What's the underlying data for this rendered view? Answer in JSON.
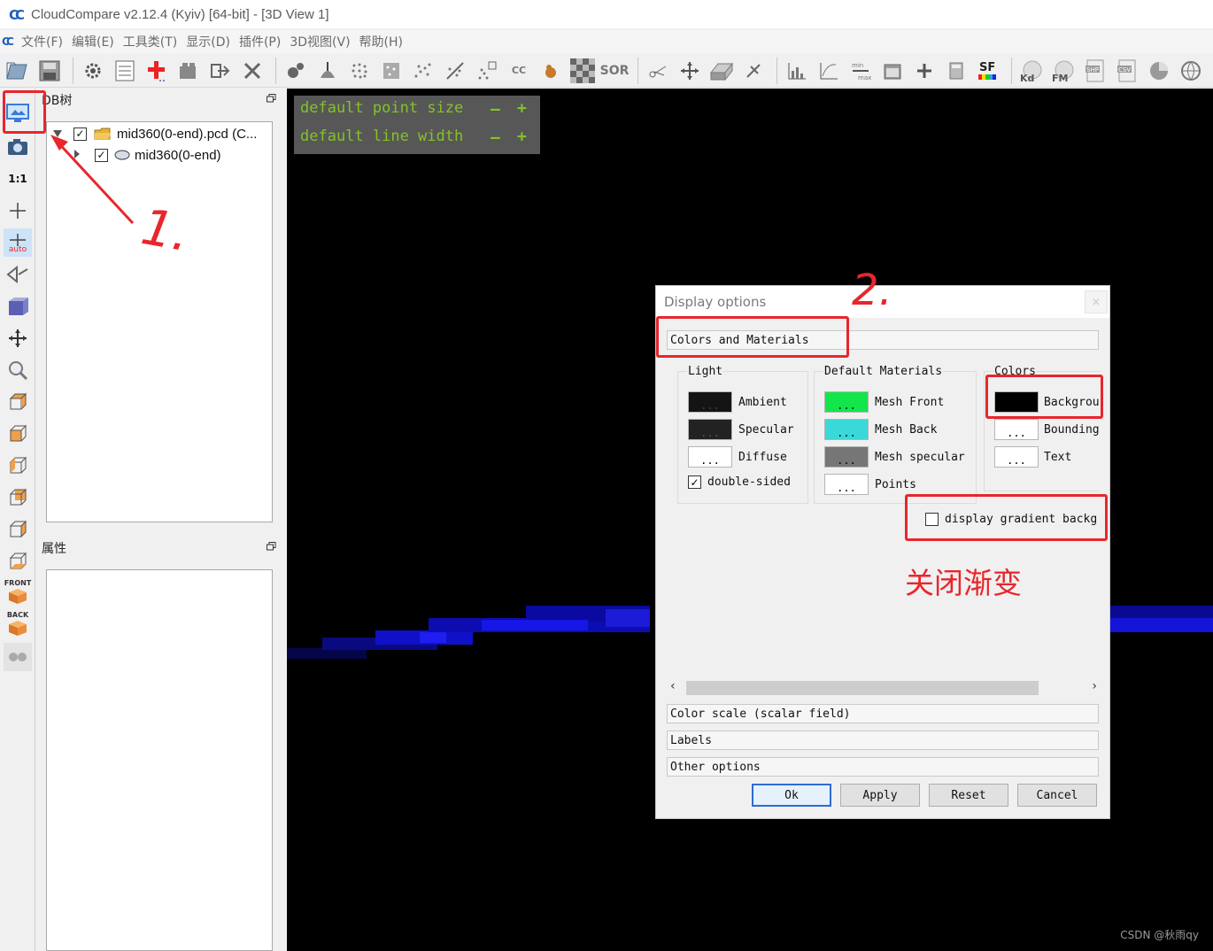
{
  "window": {
    "title": "CloudCompare v2.12.4 (Kyiv) [64-bit] - [3D View 1]",
    "logo_glyph": "C"
  },
  "menu": [
    "文件(F)",
    "编辑(E)",
    "工具类(T)",
    "显示(D)",
    "插件(P)",
    "3D视图(V)",
    "帮助(H)"
  ],
  "toolbar": {
    "sor_label": "SOR",
    "sf_label": "SF",
    "kd_label": "Kd",
    "fm_label": "FM",
    "shp_label": "SHP",
    "csv_label": "CSV",
    "cc_label": "CC"
  },
  "vtoolbar": {
    "ratio_label": "1:1",
    "auto_label": "auto",
    "front_label": "FRONT",
    "back_label": "BACK"
  },
  "db_tree": {
    "title": "DB树",
    "items": [
      {
        "label": "mid360(0-end).pcd (C...",
        "checked": "✓"
      },
      {
        "label": "mid360(0-end)",
        "checked": "✓"
      }
    ]
  },
  "properties": {
    "title": "属性"
  },
  "view3d": {
    "overlay": {
      "point_size_label": "default point size",
      "line_width_label": "default line width",
      "minus": "—",
      "plus": "+"
    },
    "watermark": "CSDN @秋雨qy"
  },
  "dialog": {
    "title": "Display options",
    "close": "×",
    "sections": {
      "colors_materials": "Colors and Materials",
      "color_scale": "Color scale (scalar field)",
      "labels": "Labels",
      "other_options": "Other options"
    },
    "light": {
      "title": "Light",
      "items": [
        {
          "label": "Ambient",
          "color": "#141414",
          "dots": "..."
        },
        {
          "label": "Specular",
          "color": "#222222",
          "dots": "..."
        },
        {
          "label": "Diffuse",
          "color": "#ffffff",
          "dots": "..."
        }
      ],
      "double_sided": {
        "label": "double-sided",
        "checked": "✓"
      }
    },
    "materials": {
      "title": "Default Materials",
      "items": [
        {
          "label": "Mesh Front",
          "color": "#12e64a",
          "dots": "..."
        },
        {
          "label": "Mesh Back",
          "color": "#3ad8d8",
          "dots": "..."
        },
        {
          "label": "Mesh specular",
          "color": "#767676",
          "dots": "..."
        },
        {
          "label": "Points",
          "color": "#ffffff",
          "dots": "..."
        }
      ]
    },
    "colors": {
      "title": "Colors",
      "items": [
        {
          "label": "Backgrou",
          "color": "#000000",
          "dots": "..."
        },
        {
          "label": "Bounding",
          "color": "#ffffff",
          "dots": "..."
        },
        {
          "label": "Text",
          "color": "#ffffff",
          "dots": "..."
        }
      ]
    },
    "gradient": {
      "label": "display gradient backg",
      "checked": ""
    },
    "scroll": {
      "left": "‹",
      "right": "›"
    },
    "buttons": {
      "ok": "Ok",
      "apply": "Apply",
      "reset": "Reset",
      "cancel": "Cancel"
    }
  },
  "annotations": {
    "step1": "1.",
    "step2": "2.",
    "note": "关闭渐变",
    "color": "#e8262c"
  }
}
